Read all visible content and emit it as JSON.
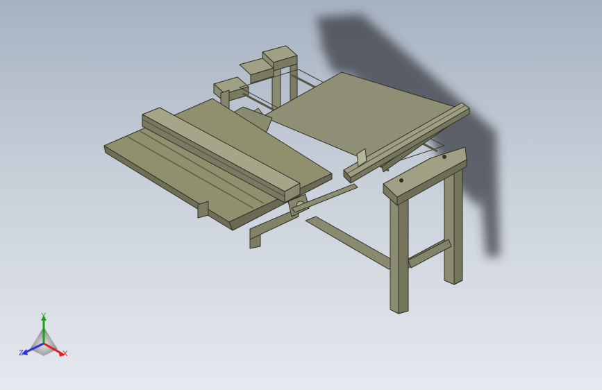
{
  "viewport": {
    "background_top": "#a6b2c1",
    "background_bottom": "#e6e9ee"
  },
  "model": {
    "part_color": "#8e8e74",
    "part_shadow_color": "#6f6f58",
    "edge_color": "#2f2f25"
  },
  "triad": {
    "x_label": "X",
    "y_label": "Y",
    "z_label": "Z",
    "x_color": "#e0201a",
    "y_color": "#1aa21a",
    "z_color": "#2a35d8"
  }
}
